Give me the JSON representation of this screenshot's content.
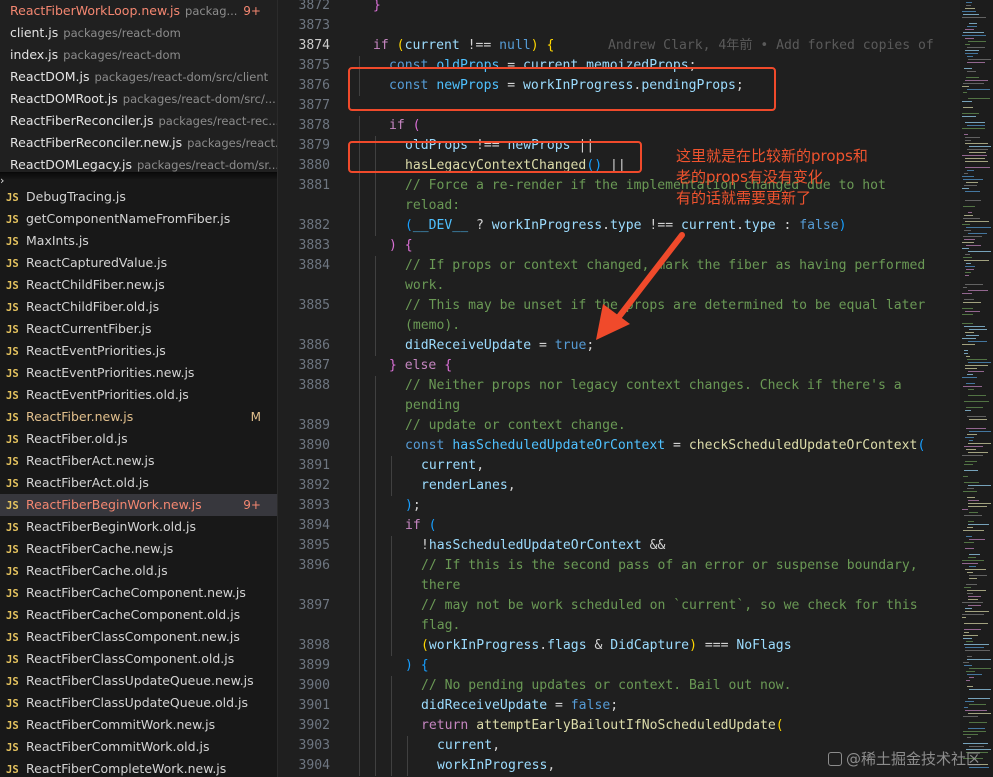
{
  "open_editors": [
    {
      "name": "ReactFiberWorkLoop.new.js",
      "path": "packag...",
      "badge": "9+",
      "state": "error"
    },
    {
      "name": "client.js",
      "path": "packages/react-dom",
      "badge": "",
      "state": ""
    },
    {
      "name": "index.js",
      "path": "packages/react-dom",
      "badge": "",
      "state": ""
    },
    {
      "name": "ReactDOM.js",
      "path": "packages/react-dom/src/client",
      "badge": "",
      "state": ""
    },
    {
      "name": "ReactDOMRoot.js",
      "path": "packages/react-dom/src/...",
      "badge": "",
      "state": ""
    },
    {
      "name": "ReactFiberReconciler.js",
      "path": "packages/react-rec...",
      "badge": "",
      "state": ""
    },
    {
      "name": "ReactFiberReconciler.new.js",
      "path": "packages/react...",
      "badge": "",
      "state": ""
    },
    {
      "name": "ReactDOMLegacy.js",
      "path": "packages/react-dom/sr...",
      "badge": "",
      "state": ""
    }
  ],
  "file_tree": [
    {
      "icon": "JS",
      "name": "DebugTracing.js",
      "badge": "",
      "state": ""
    },
    {
      "icon": "JS",
      "name": "getComponentNameFromFiber.js",
      "badge": "",
      "state": ""
    },
    {
      "icon": "JS",
      "name": "MaxInts.js",
      "badge": "",
      "state": ""
    },
    {
      "icon": "JS",
      "name": "ReactCapturedValue.js",
      "badge": "",
      "state": ""
    },
    {
      "icon": "JS",
      "name": "ReactChildFiber.new.js",
      "badge": "",
      "state": ""
    },
    {
      "icon": "JS",
      "name": "ReactChildFiber.old.js",
      "badge": "",
      "state": ""
    },
    {
      "icon": "JS",
      "name": "ReactCurrentFiber.js",
      "badge": "",
      "state": ""
    },
    {
      "icon": "JS",
      "name": "ReactEventPriorities.js",
      "badge": "",
      "state": ""
    },
    {
      "icon": "JS",
      "name": "ReactEventPriorities.new.js",
      "badge": "",
      "state": ""
    },
    {
      "icon": "JS",
      "name": "ReactEventPriorities.old.js",
      "badge": "",
      "state": ""
    },
    {
      "icon": "JS",
      "name": "ReactFiber.new.js",
      "badge": "M",
      "state": "modified"
    },
    {
      "icon": "JS",
      "name": "ReactFiber.old.js",
      "badge": "",
      "state": ""
    },
    {
      "icon": "JS",
      "name": "ReactFiberAct.new.js",
      "badge": "",
      "state": ""
    },
    {
      "icon": "JS",
      "name": "ReactFiberAct.old.js",
      "badge": "",
      "state": ""
    },
    {
      "icon": "JS",
      "name": "ReactFiberBeginWork.new.js",
      "badge": "9+",
      "state": "error selected"
    },
    {
      "icon": "JS",
      "name": "ReactFiberBeginWork.old.js",
      "badge": "",
      "state": ""
    },
    {
      "icon": "JS",
      "name": "ReactFiberCache.new.js",
      "badge": "",
      "state": ""
    },
    {
      "icon": "JS",
      "name": "ReactFiberCache.old.js",
      "badge": "",
      "state": ""
    },
    {
      "icon": "JS",
      "name": "ReactFiberCacheComponent.new.js",
      "badge": "",
      "state": ""
    },
    {
      "icon": "JS",
      "name": "ReactFiberCacheComponent.old.js",
      "badge": "",
      "state": ""
    },
    {
      "icon": "JS",
      "name": "ReactFiberClassComponent.new.js",
      "badge": "",
      "state": ""
    },
    {
      "icon": "JS",
      "name": "ReactFiberClassComponent.old.js",
      "badge": "",
      "state": ""
    },
    {
      "icon": "JS",
      "name": "ReactFiberClassUpdateQueue.new.js",
      "badge": "",
      "state": ""
    },
    {
      "icon": "JS",
      "name": "ReactFiberClassUpdateQueue.old.js",
      "badge": "",
      "state": ""
    },
    {
      "icon": "JS",
      "name": "ReactFiberCommitWork.new.js",
      "badge": "",
      "state": ""
    },
    {
      "icon": "JS",
      "name": "ReactFiberCommitWork.old.js",
      "badge": "",
      "state": ""
    },
    {
      "icon": "JS",
      "name": "ReactFiberCompleteWork.new.js",
      "badge": "",
      "state": ""
    }
  ],
  "editor": {
    "active_line": "3874",
    "blame": "Andrew Clark, 4年前 • Add forked copies of",
    "lines": [
      {
        "n": "3872",
        "indent": 0,
        "tokens": [
          [
            "b2",
            "}"
          ]
        ]
      },
      {
        "n": "3873",
        "indent": 0,
        "tokens": []
      },
      {
        "n": "3874",
        "indent": 0,
        "tokens": [
          [
            "ctl",
            "if"
          ],
          [
            "p",
            " "
          ],
          [
            "b1",
            "("
          ],
          [
            "v",
            "current"
          ],
          [
            "p",
            " !== "
          ],
          [
            "kw",
            "null"
          ],
          [
            "b1",
            ")"
          ],
          [
            "p",
            " "
          ],
          [
            "b1",
            "{"
          ]
        ]
      },
      {
        "n": "3875",
        "indent": 1,
        "tokens": [
          [
            "kw",
            "const"
          ],
          [
            "p",
            " "
          ],
          [
            "cn",
            "oldProps"
          ],
          [
            "p",
            " = "
          ],
          [
            "v",
            "current"
          ],
          [
            "p",
            "."
          ],
          [
            "v",
            "memoizedProps"
          ],
          [
            "p",
            ";"
          ]
        ]
      },
      {
        "n": "3876",
        "indent": 1,
        "tokens": [
          [
            "kw",
            "const"
          ],
          [
            "p",
            " "
          ],
          [
            "cn",
            "newProps"
          ],
          [
            "p",
            " = "
          ],
          [
            "v",
            "workInProgress"
          ],
          [
            "p",
            "."
          ],
          [
            "v",
            "pendingProps"
          ],
          [
            "p",
            ";"
          ]
        ]
      },
      {
        "n": "3877",
        "indent": 0,
        "tokens": []
      },
      {
        "n": "3878",
        "indent": 1,
        "tokens": [
          [
            "ctl",
            "if"
          ],
          [
            "p",
            " "
          ],
          [
            "b2",
            "("
          ]
        ]
      },
      {
        "n": "3879",
        "indent": 2,
        "tokens": [
          [
            "v",
            "oldProps"
          ],
          [
            "p",
            " !== "
          ],
          [
            "v",
            "newProps"
          ],
          [
            "p",
            " ||"
          ]
        ]
      },
      {
        "n": "3880",
        "indent": 2,
        "tokens": [
          [
            "fn",
            "hasLegacyContextChanged"
          ],
          [
            "b3",
            "()"
          ],
          [
            "p",
            " ||"
          ]
        ]
      },
      {
        "n": "3881",
        "indent": 2,
        "tokens": [
          [
            "cm",
            "// Force a re-render if the implementation changed due to hot"
          ]
        ]
      },
      {
        "n": "",
        "indent": 2,
        "tokens": [
          [
            "cm",
            "reload:"
          ]
        ]
      },
      {
        "n": "3882",
        "indent": 2,
        "tokens": [
          [
            "b3",
            "("
          ],
          [
            "cn",
            "__DEV__"
          ],
          [
            "p",
            " ? "
          ],
          [
            "v",
            "workInProgress"
          ],
          [
            "p",
            "."
          ],
          [
            "v",
            "type"
          ],
          [
            "p",
            " !== "
          ],
          [
            "v",
            "current"
          ],
          [
            "p",
            "."
          ],
          [
            "v",
            "type"
          ],
          [
            "p",
            " : "
          ],
          [
            "kw",
            "false"
          ],
          [
            "b3",
            ")"
          ]
        ]
      },
      {
        "n": "3883",
        "indent": 1,
        "tokens": [
          [
            "b2",
            ")"
          ],
          [
            "p",
            " "
          ],
          [
            "b2",
            "{"
          ]
        ]
      },
      {
        "n": "3884",
        "indent": 2,
        "tokens": [
          [
            "cm",
            "// If props or context changed, mark the fiber as having performed"
          ]
        ]
      },
      {
        "n": "",
        "indent": 2,
        "tokens": [
          [
            "cm",
            "work."
          ]
        ]
      },
      {
        "n": "3885",
        "indent": 2,
        "tokens": [
          [
            "cm",
            "// This may be unset if the props are determined to be equal later"
          ]
        ]
      },
      {
        "n": "",
        "indent": 2,
        "tokens": [
          [
            "cm",
            "(memo)."
          ]
        ]
      },
      {
        "n": "3886",
        "indent": 2,
        "tokens": [
          [
            "v",
            "didReceiveUpdate"
          ],
          [
            "p",
            " = "
          ],
          [
            "kw",
            "true"
          ],
          [
            "p",
            ";"
          ]
        ]
      },
      {
        "n": "3887",
        "indent": 1,
        "tokens": [
          [
            "b2",
            "}"
          ],
          [
            "p",
            " "
          ],
          [
            "ctl",
            "else"
          ],
          [
            "p",
            " "
          ],
          [
            "b2",
            "{"
          ]
        ]
      },
      {
        "n": "3888",
        "indent": 2,
        "tokens": [
          [
            "cm",
            "// Neither props nor legacy context changes. Check if there's a"
          ]
        ]
      },
      {
        "n": "",
        "indent": 2,
        "tokens": [
          [
            "cm",
            "pending"
          ]
        ]
      },
      {
        "n": "3889",
        "indent": 2,
        "tokens": [
          [
            "cm",
            "// update or context change."
          ]
        ]
      },
      {
        "n": "3890",
        "indent": 2,
        "tokens": [
          [
            "kw",
            "const"
          ],
          [
            "p",
            " "
          ],
          [
            "cn",
            "hasScheduledUpdateOrContext"
          ],
          [
            "p",
            " = "
          ],
          [
            "fn",
            "checkScheduledUpdateOrContext"
          ],
          [
            "b3",
            "("
          ]
        ]
      },
      {
        "n": "3891",
        "indent": 3,
        "tokens": [
          [
            "v",
            "current"
          ],
          [
            "p",
            ","
          ]
        ]
      },
      {
        "n": "3892",
        "indent": 3,
        "tokens": [
          [
            "v",
            "renderLanes"
          ],
          [
            "p",
            ","
          ]
        ]
      },
      {
        "n": "3893",
        "indent": 2,
        "tokens": [
          [
            "b3",
            ")"
          ],
          [
            "p",
            ";"
          ]
        ]
      },
      {
        "n": "3894",
        "indent": 2,
        "tokens": [
          [
            "ctl",
            "if"
          ],
          [
            "p",
            " "
          ],
          [
            "b3",
            "("
          ]
        ]
      },
      {
        "n": "3895",
        "indent": 3,
        "tokens": [
          [
            "p",
            "!"
          ],
          [
            "v",
            "hasScheduledUpdateOrContext"
          ],
          [
            "p",
            " &&"
          ]
        ]
      },
      {
        "n": "3896",
        "indent": 3,
        "tokens": [
          [
            "cm",
            "// If this is the second pass of an error or suspense boundary,"
          ]
        ]
      },
      {
        "n": "",
        "indent": 3,
        "tokens": [
          [
            "cm",
            "there"
          ]
        ]
      },
      {
        "n": "3897",
        "indent": 3,
        "tokens": [
          [
            "cm",
            "// may not be work scheduled on `current`, so we check for this"
          ]
        ]
      },
      {
        "n": "",
        "indent": 3,
        "tokens": [
          [
            "cm",
            "flag."
          ]
        ]
      },
      {
        "n": "3898",
        "indent": 3,
        "tokens": [
          [
            "b1",
            "("
          ],
          [
            "v",
            "workInProgress"
          ],
          [
            "p",
            "."
          ],
          [
            "v",
            "flags"
          ],
          [
            "p",
            " & "
          ],
          [
            "v",
            "DidCapture"
          ],
          [
            "b1",
            ")"
          ],
          [
            "p",
            " === "
          ],
          [
            "v",
            "NoFlags"
          ]
        ]
      },
      {
        "n": "3899",
        "indent": 2,
        "tokens": [
          [
            "b3",
            ")"
          ],
          [
            "p",
            " "
          ],
          [
            "b3",
            "{"
          ]
        ]
      },
      {
        "n": "3900",
        "indent": 3,
        "tokens": [
          [
            "cm",
            "// No pending updates or context. Bail out now."
          ]
        ]
      },
      {
        "n": "3901",
        "indent": 3,
        "tokens": [
          [
            "v",
            "didReceiveUpdate"
          ],
          [
            "p",
            " = "
          ],
          [
            "kw",
            "false"
          ],
          [
            "p",
            ";"
          ]
        ]
      },
      {
        "n": "3902",
        "indent": 3,
        "tokens": [
          [
            "ctl",
            "return"
          ],
          [
            "p",
            " "
          ],
          [
            "fn",
            "attemptEarlyBailoutIfNoScheduledUpdate"
          ],
          [
            "b1",
            "("
          ]
        ]
      },
      {
        "n": "3903",
        "indent": 4,
        "tokens": [
          [
            "v",
            "current"
          ],
          [
            "p",
            ","
          ]
        ]
      },
      {
        "n": "3904",
        "indent": 4,
        "tokens": [
          [
            "v",
            "workInProgress"
          ],
          [
            "p",
            ","
          ]
        ]
      }
    ]
  },
  "annotation": {
    "text_lines": [
      "这里就是在比较新的props和",
      "老的props有没有变化",
      "有的话就需要更新了"
    ],
    "color": "#f04a2b"
  },
  "watermark": "@稀土掘金技术社区",
  "colors": {
    "accent_error": "#f48771",
    "accent_modified": "#e2c08d",
    "annotation": "#f04a2b"
  }
}
